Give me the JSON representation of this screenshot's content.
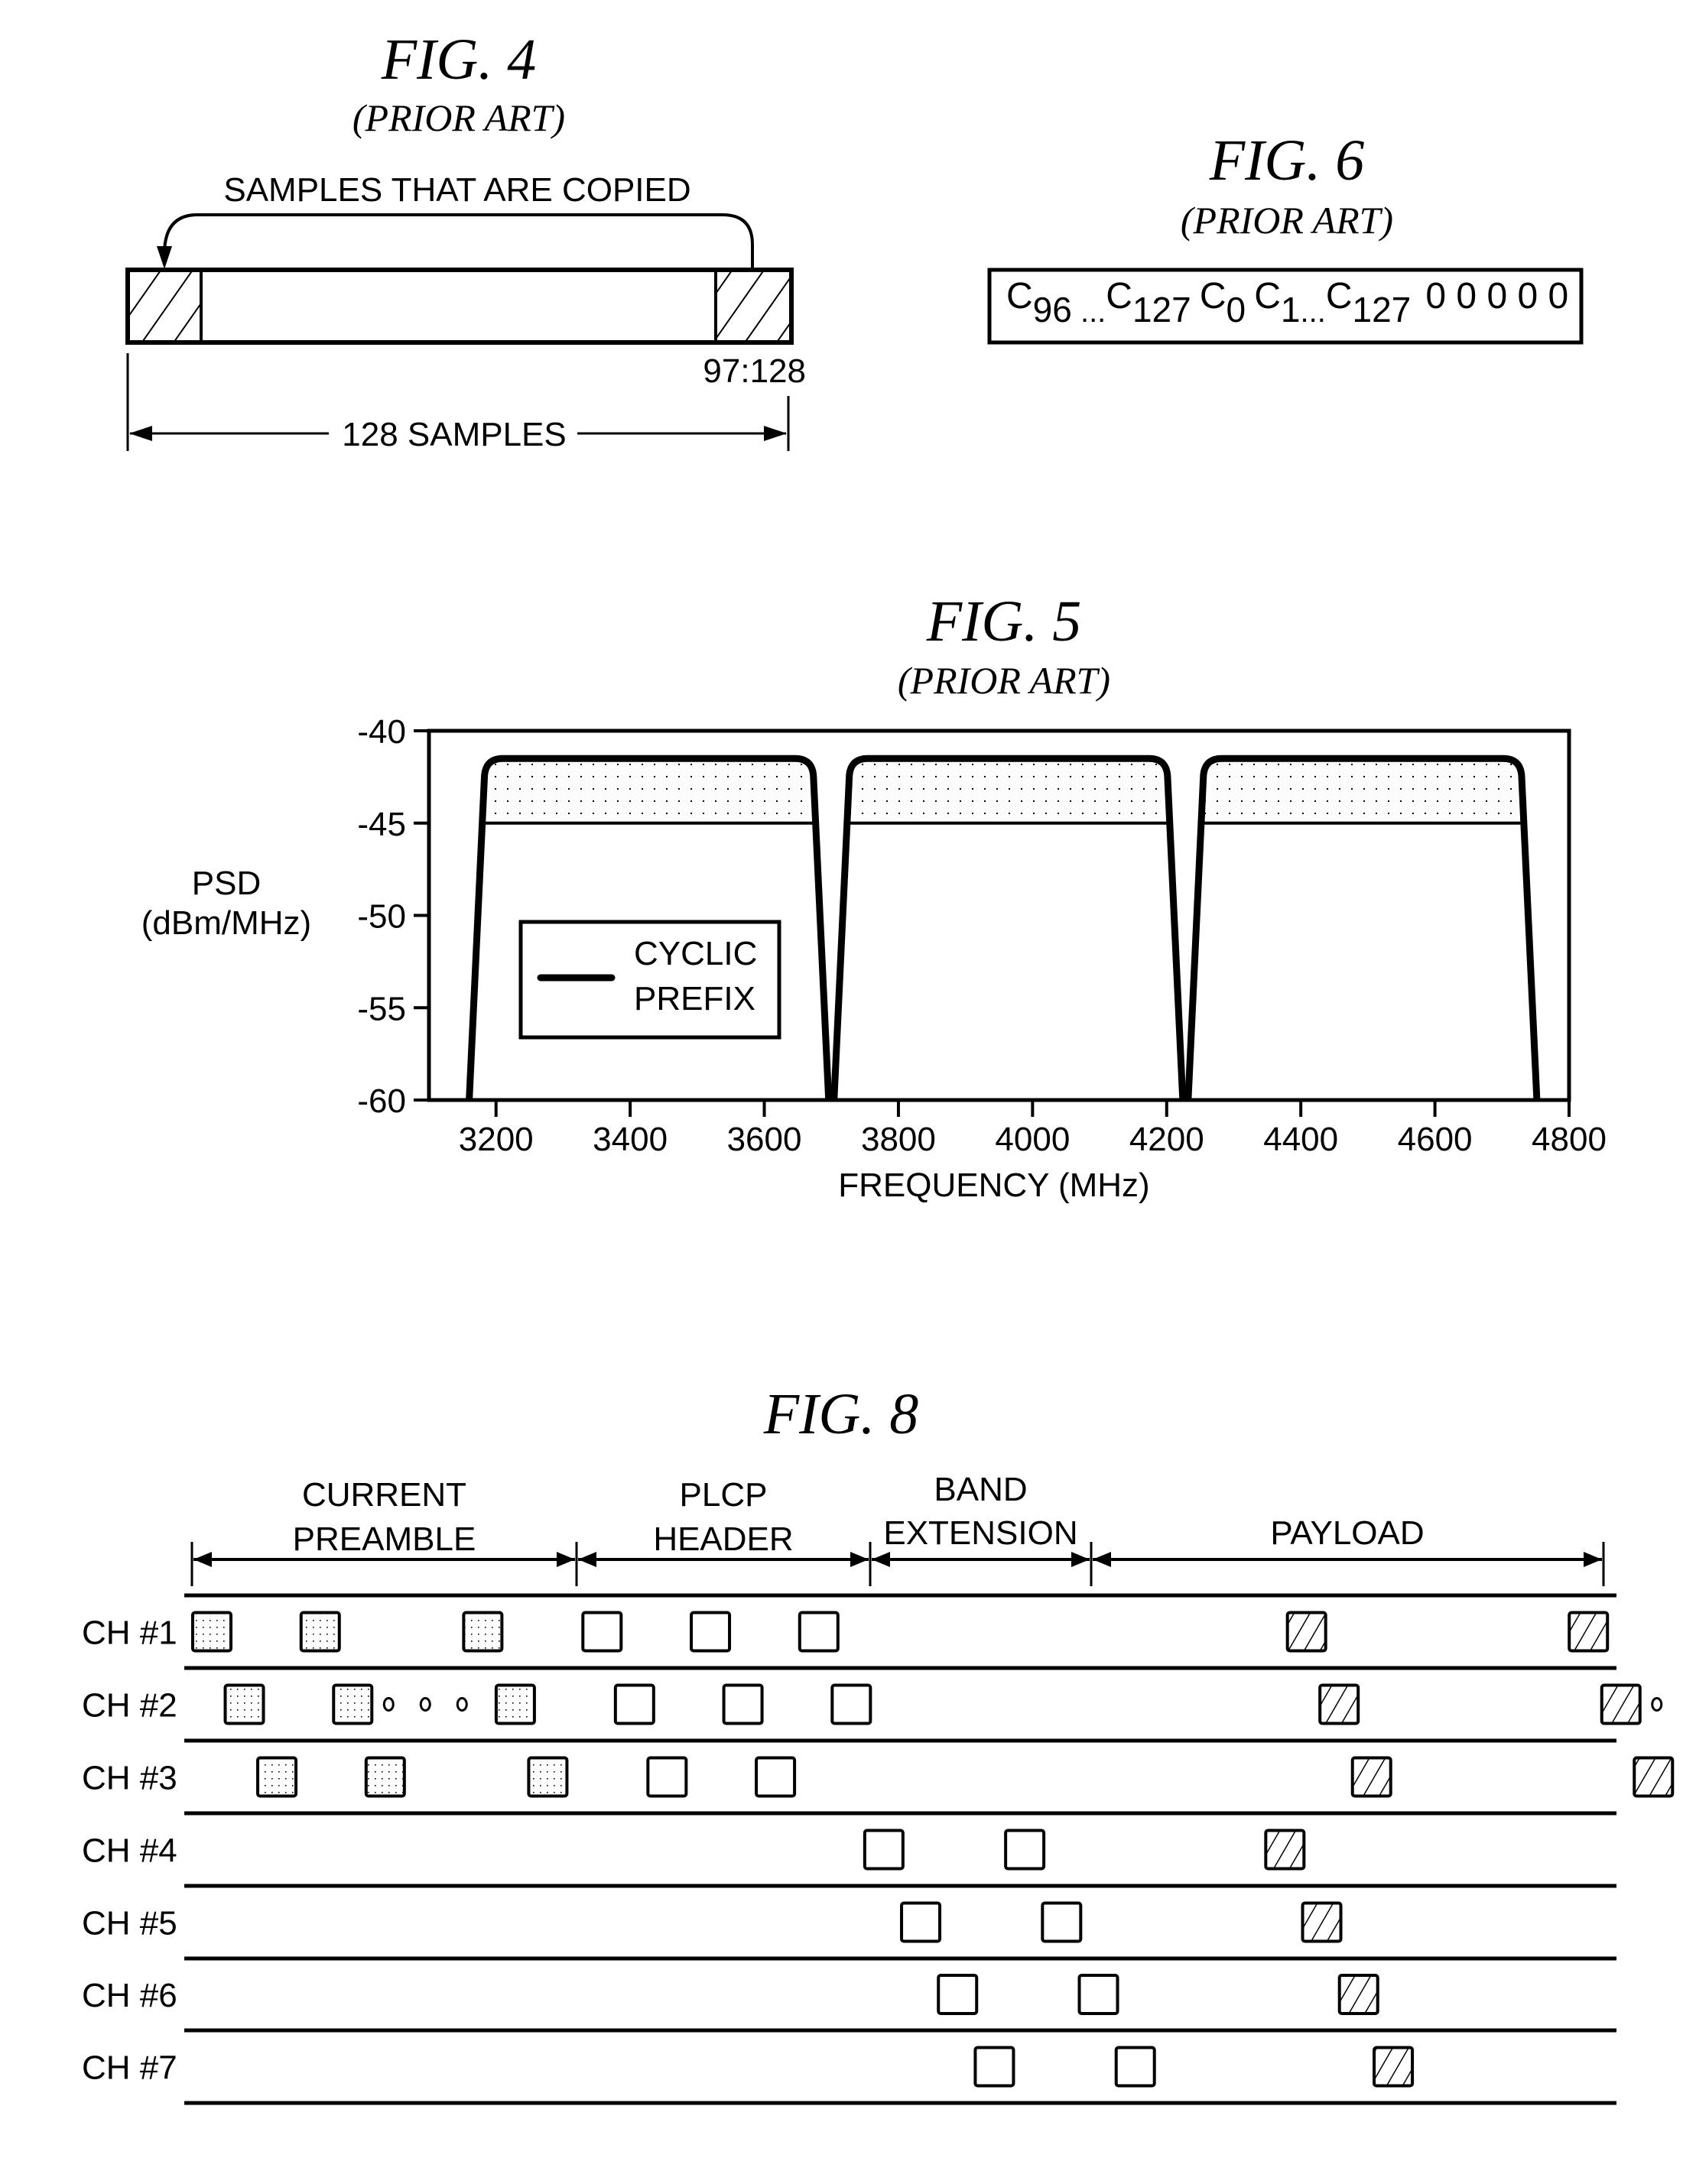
{
  "fig4": {
    "title": "FIG. 4",
    "subtitle": "(PRIOR ART)",
    "arrow_label": "SAMPLES THAT ARE COPIED",
    "range_label": "97:128",
    "span_label": "128 SAMPLES",
    "total_samples": 128,
    "copied_range": [
      97,
      128
    ]
  },
  "fig6": {
    "title": "FIG. 6",
    "subtitle": "(PRIOR ART)",
    "tokens": [
      {
        "base": "C",
        "sub": "96",
        "after": " ..."
      },
      {
        "base": "C",
        "sub": "127",
        "after": " "
      },
      {
        "base": "C",
        "sub": "0",
        "after": " "
      },
      {
        "base": "C",
        "sub": "1",
        "after": "..."
      },
      {
        "base": "C",
        "sub": "127",
        "after": " "
      }
    ],
    "zeros": "0 0 0 0 0"
  },
  "fig5": {
    "title": "FIG. 5",
    "subtitle": "(PRIOR ART)",
    "legend_line1": "CYCLIC",
    "legend_line2": "PREFIX"
  },
  "chart_data": {
    "type": "area",
    "title": "FIG. 5 (PRIOR ART)",
    "xlabel": "FREQUENCY (MHz)",
    "ylabel_line1": "PSD",
    "ylabel_line2": "(dBm/MHz)",
    "xlim": [
      3100,
      4800
    ],
    "ylim": [
      -60,
      -40
    ],
    "xticks": [
      3200,
      3400,
      3600,
      3800,
      4000,
      4200,
      4400,
      4600,
      4800
    ],
    "yticks": [
      -40,
      -45,
      -50,
      -55,
      -60
    ],
    "grid": false,
    "legend": {
      "position": "center-left",
      "entries": [
        "CYCLIC PREFIX"
      ]
    },
    "series": [
      {
        "name": "CYCLIC PREFIX",
        "bands": [
          {
            "start": 3160,
            "end": 3696,
            "peak": -41.5,
            "base": -45
          },
          {
            "start": 3704,
            "end": 4224,
            "peak": -41.5,
            "base": -45
          },
          {
            "start": 4232,
            "end": 4752,
            "peak": -41.5,
            "base": -45
          }
        ],
        "floor": -60
      }
    ]
  },
  "fig8": {
    "title": "FIG. 8",
    "sections": [
      {
        "line1": "CURRENT",
        "line2": "PREAMBLE"
      },
      {
        "line1": "PLCP",
        "line2": "HEADER"
      },
      {
        "line1": "BAND",
        "line2": "EXTENSION"
      },
      {
        "line1": "",
        "line2": "PAYLOAD"
      }
    ],
    "channels": [
      {
        "label": "CH #1",
        "blocks": [
          {
            "t": 0.0,
            "kind": "preamble"
          },
          {
            "t": 0.5,
            "kind": "preamble"
          },
          {
            "t": 1.25,
            "kind": "preamble"
          },
          {
            "t": 1.8,
            "kind": "header"
          },
          {
            "t": 2.3,
            "kind": "header"
          },
          {
            "t": 2.8,
            "kind": "header"
          },
          {
            "t": 5.05,
            "kind": "payload"
          },
          {
            "t": 6.35,
            "kind": "payload"
          }
        ],
        "ellipsis_after": null
      },
      {
        "label": "CH #2",
        "blocks": [
          {
            "t": 0.15,
            "kind": "preamble"
          },
          {
            "t": 0.65,
            "kind": "preamble"
          },
          {
            "t": 1.4,
            "kind": "preamble"
          },
          {
            "t": 1.95,
            "kind": "header"
          },
          {
            "t": 2.45,
            "kind": "header"
          },
          {
            "t": 2.95,
            "kind": "header"
          },
          {
            "t": 5.2,
            "kind": "payload"
          },
          {
            "t": 6.5,
            "kind": "payload"
          }
        ],
        "ellipsis_after": [
          1,
          7
        ]
      },
      {
        "label": "CH #3",
        "blocks": [
          {
            "t": 0.3,
            "kind": "preamble"
          },
          {
            "t": 0.8,
            "kind": "preamble"
          },
          {
            "t": 1.55,
            "kind": "preamble"
          },
          {
            "t": 2.1,
            "kind": "header"
          },
          {
            "t": 2.6,
            "kind": "header"
          },
          {
            "t": 5.35,
            "kind": "payload"
          },
          {
            "t": 6.65,
            "kind": "payload"
          }
        ],
        "ellipsis_after": null
      },
      {
        "label": "CH #4",
        "blocks": [
          {
            "t": 3.1,
            "kind": "header"
          },
          {
            "t": 3.75,
            "kind": "header"
          },
          {
            "t": 4.95,
            "kind": "payload"
          }
        ],
        "ellipsis_after": null
      },
      {
        "label": "CH #5",
        "blocks": [
          {
            "t": 3.27,
            "kind": "header"
          },
          {
            "t": 3.92,
            "kind": "header"
          },
          {
            "t": 5.12,
            "kind": "payload"
          }
        ],
        "ellipsis_after": null
      },
      {
        "label": "CH #6",
        "blocks": [
          {
            "t": 3.44,
            "kind": "header"
          },
          {
            "t": 4.09,
            "kind": "header"
          },
          {
            "t": 5.29,
            "kind": "payload"
          }
        ],
        "ellipsis_after": null
      },
      {
        "label": "CH #7",
        "blocks": [
          {
            "t": 3.61,
            "kind": "header"
          },
          {
            "t": 4.26,
            "kind": "header"
          },
          {
            "t": 5.45,
            "kind": "payload"
          }
        ],
        "ellipsis_after": null
      }
    ]
  }
}
